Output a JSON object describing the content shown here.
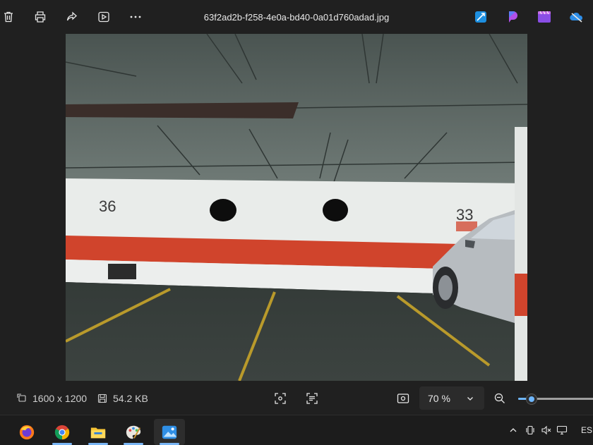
{
  "toolbar": {
    "filename": "63f2ad2b-f258-4e0a-bd40-0a01d760adad.jpg",
    "actions": [
      "delete-icon",
      "print-icon",
      "share-icon",
      "slideshow-icon",
      "more-icon"
    ],
    "apps": [
      "designer-icon",
      "clipchamp-icon",
      "video-editor-icon",
      "onedrive-icon"
    ]
  },
  "photo": {
    "spot_left": "36",
    "spot_right": "33",
    "colors": {
      "ceiling": "#4a5451",
      "wall": "#e9ecea",
      "stripe": "#d0442c",
      "floor": "#343b38",
      "line": "#b99a2b"
    }
  },
  "status": {
    "dimensions": "1600 x 1200",
    "size": "54.2 KB",
    "zoom": "70 %",
    "zoom_level": 0.16
  },
  "taskbar": {
    "apps": [
      "firefox-icon",
      "chrome-icon",
      "file-explorer-icon",
      "paint-icon",
      "photos-icon"
    ],
    "active_app": "photos-icon",
    "tray_text": "ESP"
  }
}
